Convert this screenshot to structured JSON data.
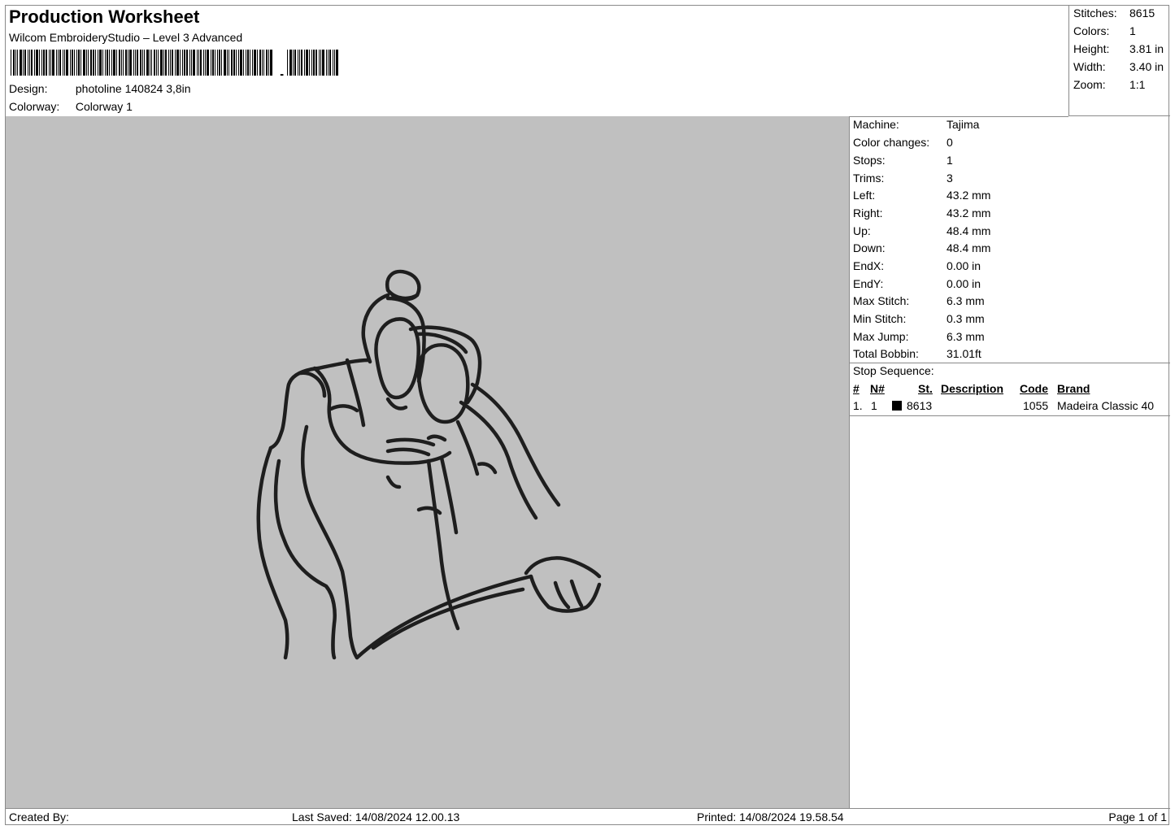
{
  "header": {
    "title": "Production Worksheet",
    "software": "Wilcom EmbroideryStudio – Level 3 Advanced",
    "design_label": "Design:",
    "design_value": "photoline 140824 3,8in",
    "colorway_label": "Colorway:",
    "colorway_value": "Colorway 1"
  },
  "stats": [
    {
      "label": "Stitches:",
      "value": "8615"
    },
    {
      "label": "Colors:",
      "value": "1"
    },
    {
      "label": "Height:",
      "value": "3.81 in"
    },
    {
      "label": "Width:",
      "value": "3.40 in"
    },
    {
      "label": "Zoom:",
      "value": "1:1"
    }
  ],
  "machine": [
    {
      "label": "Machine:",
      "value": "Tajima"
    },
    {
      "label": "Color changes:",
      "value": "0"
    },
    {
      "label": "Stops:",
      "value": "1"
    },
    {
      "label": "Trims:",
      "value": "3"
    },
    {
      "label": "Left:",
      "value": "43.2 mm"
    },
    {
      "label": "Right:",
      "value": "43.2 mm"
    },
    {
      "label": "Up:",
      "value": "48.4 mm"
    },
    {
      "label": "Down:",
      "value": "48.4 mm"
    },
    {
      "label": "EndX:",
      "value": "0.00 in"
    },
    {
      "label": "EndY:",
      "value": "0.00 in"
    },
    {
      "label": "Max Stitch:",
      "value": "6.3 mm"
    },
    {
      "label": "Min Stitch:",
      "value": "0.3 mm"
    },
    {
      "label": "Max Jump:",
      "value": "6.3 mm"
    },
    {
      "label": "Total Bobbin:",
      "value": "31.01ft"
    }
  ],
  "stop_sequence": {
    "title": "Stop Sequence:",
    "columns": {
      "num": "#",
      "n": "N#",
      "st": "St.",
      "description": "Description",
      "code": "Code",
      "brand": "Brand"
    },
    "rows": [
      {
        "num": "1.",
        "n": "1",
        "swatch_color": "#000000",
        "st": "8613",
        "description": "",
        "code": "1055",
        "brand": "Madeira Classic 40"
      }
    ]
  },
  "footer": {
    "created_by": "Created By:",
    "last_saved": "Last Saved: 14/08/2024 12.00.13",
    "printed": "Printed: 14/08/2024 19.58.54",
    "page": "Page 1 of 1"
  },
  "colors": {
    "preview_background": "#c0c0c0",
    "thread": "#1e1e1e"
  }
}
